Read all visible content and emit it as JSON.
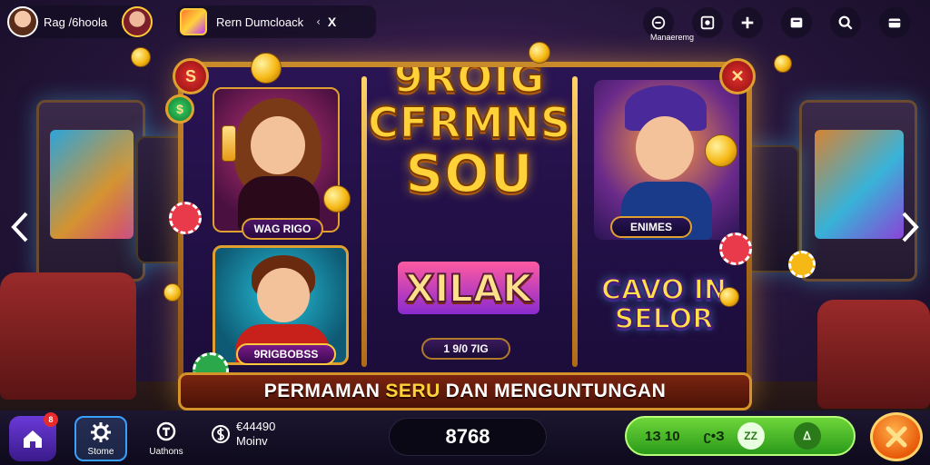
{
  "topbar": {
    "user_name": "Rag /6hoola",
    "room_title": "Rern Dumcloack",
    "room_separator": "‹",
    "room_close": "X",
    "icons": [
      {
        "name": "profile-icon"
      },
      {
        "name": "photo-icon"
      },
      {
        "name": "add-icon"
      },
      {
        "name": "card-icon"
      },
      {
        "name": "search-icon"
      },
      {
        "name": "wallet-icon"
      }
    ],
    "icon_label": "Manaeremg"
  },
  "board": {
    "title_line1": "9ROIG",
    "title_line2": "CFRMNS",
    "title_line3": "SOU",
    "card_tl_label": "WAG RIGO",
    "card_bl_label": "9RIGBOBSS",
    "card_tr_label": "ENIMES",
    "card_mid_logo": "XILAK",
    "card_mid_label": "1 9/0 7IG",
    "card_br_logo_line1": "CAVO IN",
    "card_br_logo_line2": "SELOR",
    "emblem_left": "S",
    "emblem_right": "✕",
    "emblem_leaf": "$"
  },
  "banner": {
    "text_before": "PERMAMAN ",
    "text_highlight": "SERU",
    "text_after": " DAN MENGUNTUNGAN"
  },
  "bottombar": {
    "home_badge": "8",
    "nav": [
      {
        "label": "Stome"
      },
      {
        "label": "Uathons"
      }
    ],
    "balance_line1": "€44490",
    "balance_line2": "Moinv",
    "score": "8768",
    "pill_left": "1З 10",
    "pill_mid": "ʗ•З",
    "pill_knob1": "ZZ",
    "pill_knob2": "ᐃ"
  },
  "colors": {
    "gold": "#ffd23a",
    "accent_blue": "#3aa0ff",
    "green": "#6ed63a",
    "orange": "#e85a0a"
  }
}
